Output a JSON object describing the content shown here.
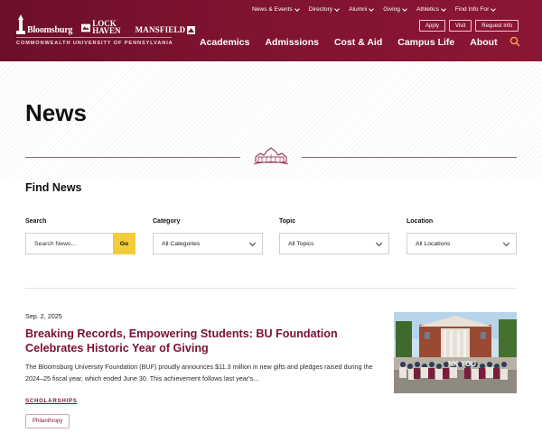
{
  "header": {
    "logos": {
      "bloomsburg": "Bloomsburg",
      "lock_haven": "LOCK HAVEN",
      "mansfield": "MANSFIELD"
    },
    "tagline": "COMMONWEALTH UNIVERSITY OF PENNSYLVANIA",
    "utility_nav": [
      {
        "label": "News & Events",
        "icon": "chevron-down-icon"
      },
      {
        "label": "Directory",
        "icon": "chevron-down-icon"
      },
      {
        "label": "Alumni",
        "icon": "chevron-down-icon"
      },
      {
        "label": "Giving",
        "icon": "chevron-down-icon"
      },
      {
        "label": "Athletics",
        "icon": "chevron-down-icon"
      },
      {
        "label": "Find Info For",
        "icon": "chevron-down-icon"
      }
    ],
    "cta_buttons": [
      "Apply",
      "Visit",
      "Request Info"
    ],
    "main_nav": [
      "Academics",
      "Admissions",
      "Cost & Aid",
      "Campus Life",
      "About"
    ],
    "search_icon": "search-icon",
    "colors": {
      "brand": "#7f1330",
      "accent": "#f3cc3c"
    }
  },
  "page": {
    "title": "News",
    "find_title": "Find News"
  },
  "filters": {
    "search": {
      "label": "Search",
      "placeholder": "Search News...",
      "button": "Go"
    },
    "category": {
      "label": "Category",
      "value": "All Categories"
    },
    "topic": {
      "label": "Topic",
      "value": "All Topics"
    },
    "location": {
      "label": "Location",
      "value": "All Locations"
    }
  },
  "articles": [
    {
      "date": "Sep. 2, 2025",
      "title": "Breaking Records, Empowering Students: BU Foundation Celebrates Historic Year of Giving",
      "summary": "The Bloomsburg University Foundation (BUF) proudly announces $11.3 million in new gifts and pledges raised during the 2024–25 fiscal year, which ended June 30. This achievement follows last year's...",
      "category": "SCHOLARSHIPS",
      "tag": "Philanthropy",
      "photo_overlay": "NK YOU"
    }
  ]
}
